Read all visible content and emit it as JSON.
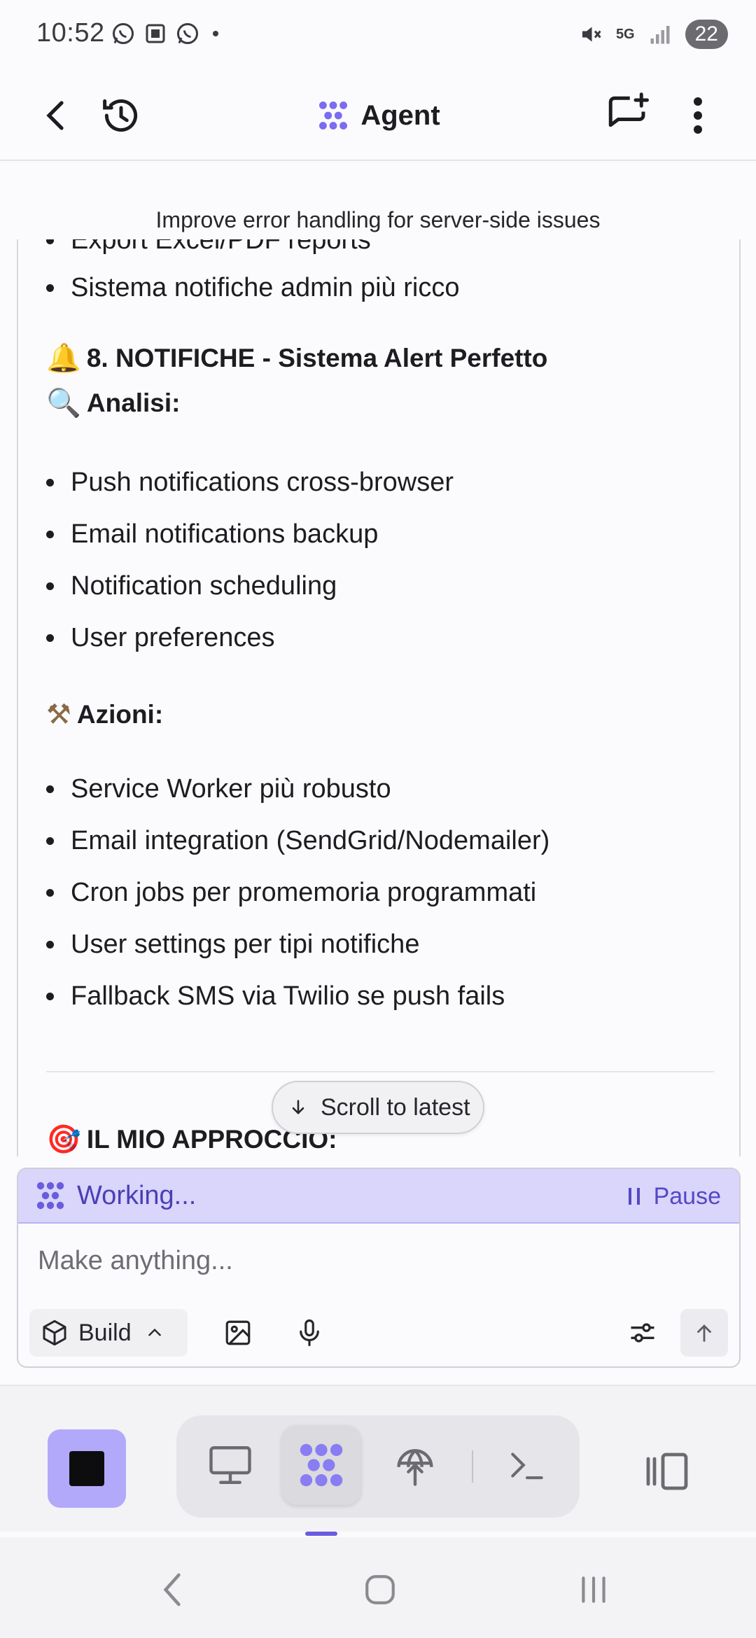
{
  "status_bar": {
    "time": "10:52",
    "battery": "22",
    "network": "5G"
  },
  "header": {
    "title": "Agent"
  },
  "notice": "Improve error handling for server-side issues",
  "chat": {
    "partial_top": "Export Excel/PDF reports",
    "bullet_top": "Sistema notifiche admin più ricco",
    "section_title": "8. NOTIFICHE - Sistema Alert Perfetto",
    "section_emoji": "🔔",
    "analysis_title": "Analisi:",
    "analysis_emoji": "🔍",
    "analysis_items": [
      "Push notifications cross-browser",
      "Email notifications backup",
      "Notification scheduling",
      "User preferences"
    ],
    "actions_title": "Azioni:",
    "actions_emoji": "⚒",
    "actions_items": [
      "Service Worker più robusto",
      "Email integration (SendGrid/Nodemailer)",
      "Cron jobs per promemoria programmati",
      "User settings per tipi notifiche",
      "Fallback SMS via Twilio se push fails"
    ],
    "approach_title": "IL MIO APPROCCIO:",
    "approach_emoji": "🎯"
  },
  "scroll_button": {
    "label": "Scroll to latest"
  },
  "working": {
    "status": "Working...",
    "pause_label": "Pause"
  },
  "composer": {
    "placeholder": "Make anything...",
    "mode_label": "Build"
  },
  "colors": {
    "accent": "#7c6cf0",
    "working_bg": "#d9d5fb",
    "stop_bg": "#b2a9fb"
  }
}
